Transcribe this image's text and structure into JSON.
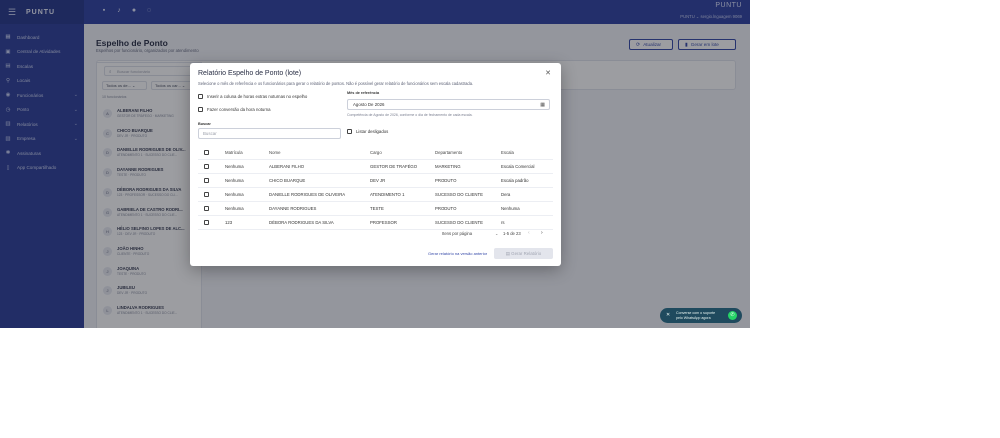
{
  "sidebar": {
    "brand": "PUNTU",
    "items": [
      {
        "label": "Dashboard",
        "icon": "dashboard-icon",
        "glyph": "▦",
        "chevron": ""
      },
      {
        "label": "Central de Atividades",
        "icon": "clipboard-icon",
        "glyph": "▣",
        "chevron": ""
      },
      {
        "label": "Escalas",
        "icon": "grid-icon",
        "glyph": "▤",
        "chevron": ""
      },
      {
        "label": "Locais",
        "icon": "location-pin-icon",
        "glyph": "⚲",
        "chevron": ""
      },
      {
        "label": "Funcionários",
        "icon": "people-icon",
        "glyph": "◉",
        "chevron": "⌄"
      },
      {
        "label": "Ponto",
        "icon": "clock-icon",
        "glyph": "◷",
        "chevron": "⌄"
      },
      {
        "label": "Relatórios",
        "icon": "report-icon",
        "glyph": "▥",
        "chevron": "⌄"
      },
      {
        "label": "Empresa",
        "icon": "building-icon",
        "glyph": "▧",
        "chevron": "⌄"
      },
      {
        "label": "Assinaturas",
        "icon": "star-icon",
        "glyph": "✱",
        "chevron": ""
      },
      {
        "label": "App Compartilhado",
        "icon": "phone-icon",
        "glyph": "▯",
        "chevron": ""
      }
    ]
  },
  "topbar": {
    "brand": "PUNTU",
    "user": "PUNTU  ⌄   sergio.lnguagem 9069"
  },
  "page": {
    "title": "Espelho de Ponto",
    "subtitle": "Espelhos por funcionário, organizados por atendimento",
    "refresh_label": "Atualizar",
    "generate_batch_label": "Gerar em lote",
    "search_placeholder": "Buscar funcionário",
    "filter1": "Todos os de...  ⌄",
    "filter2": "Todos os car...  ⌄",
    "count": "10 funcionários"
  },
  "employees": [
    {
      "initial": "A",
      "name": "ALBERANI FILHO",
      "dept": "GESTOR DE TRÁFEGO · MARKETING"
    },
    {
      "initial": "C",
      "name": "CHICO BUARQUE",
      "dept": "DEV JR · PRODUTO"
    },
    {
      "initial": "D",
      "name": "DANIELLE RODRIGUES DE OLIV...",
      "dept": "ATENDIMENTO 1 · SUCESSO DO CLIE..."
    },
    {
      "initial": "D",
      "name": "DAYANNE RODRIGUES",
      "dept": "TESTE · PRODUTO"
    },
    {
      "initial": "D",
      "name": "DÉBORA RODRIGUES DA SILVA",
      "dept": "123 · PROFESSOR · SUCESSO DO CLI..."
    },
    {
      "initial": "G",
      "name": "GABRIELA DE CASTRO RODRI...",
      "dept": "ATENDIMENTO 1 · SUCESSO DO CLIE..."
    },
    {
      "initial": "H",
      "name": "HÉLIO SELFINO LOPES DE ALC...",
      "dept": "123 · DEV JR · PRODUTO"
    },
    {
      "initial": "J",
      "name": "JOÃO HINHO",
      "dept": "CLIENTE · PRODUTO"
    },
    {
      "initial": "J",
      "name": "JOAQUINA",
      "dept": "TESTE · PRODUTO"
    },
    {
      "initial": "J",
      "name": "JUBILEU",
      "dept": "DEV JR · PRODUTO"
    },
    {
      "initial": "L",
      "name": "LINDALVA RODRIGUES",
      "dept": "ATENDIMENTO 1 · SUCESSO DO CLIE..."
    }
  ],
  "modal": {
    "title": "Relatório Espelho de Ponto (lote)",
    "description": "Selecione o mês de referência e os funcionários para gerar o relatório de pontos. Não é possível gerar relatório de funcionários sem escala cadastrada.",
    "option_night": "Inserir a coluna de horas extras noturnas no espelho",
    "option_convert": "Fazer conversão da hora noturna",
    "month_label": "Mês de referência",
    "month_value": "Agosto De 2026",
    "month_hint": "Competência de Agosto de 2026, conforme o dia de fechamento de cada escala.",
    "search_label": "Buscar",
    "search_placeholder": "Buscar",
    "list_disabled": "Listar desligados",
    "columns": [
      "Matrícula",
      "Nome",
      "Cargo",
      "Departamento",
      "Escala"
    ],
    "rows": [
      {
        "matricula": "Nenhuma",
        "nome": "ALBERANI FILHO",
        "cargo": "GESTOR DE TRAFÉGO",
        "departamento": "MARKETING",
        "escala": "Escala Comercial"
      },
      {
        "matricula": "Nenhuma",
        "nome": "CHICO BUARQUE",
        "cargo": "DEV JR",
        "departamento": "PRODUTO",
        "escala": "Escala padrão"
      },
      {
        "matricula": "Nenhuma",
        "nome": "DANIELLE RODRIGUES DE OLIVEIRA",
        "cargo": "ATENDIMENTO 1",
        "departamento": "SUCESSO DO CLIENTE",
        "escala": "Dera"
      },
      {
        "matricula": "Nenhuma",
        "nome": "DAYANNE RODRIGUES",
        "cargo": "TESTE",
        "departamento": "PRODUTO",
        "escala": "Nenhuma"
      },
      {
        "matricula": "123",
        "nome": "DÉBORA RODRIGUES DA SILVA",
        "cargo": "PROFESSOR",
        "departamento": "SUCESSO DO CLIENTE",
        "escala": "rs"
      }
    ],
    "items_per_page_label": "Itens por página",
    "range": "1-5 de 23",
    "old_version_link": "Gerar relatório na versão anterior",
    "generate_label": "Gerar Relatório"
  },
  "whatsapp": {
    "line1": "Converse com o suporte",
    "line2": "pelo WhatsApp agora"
  }
}
